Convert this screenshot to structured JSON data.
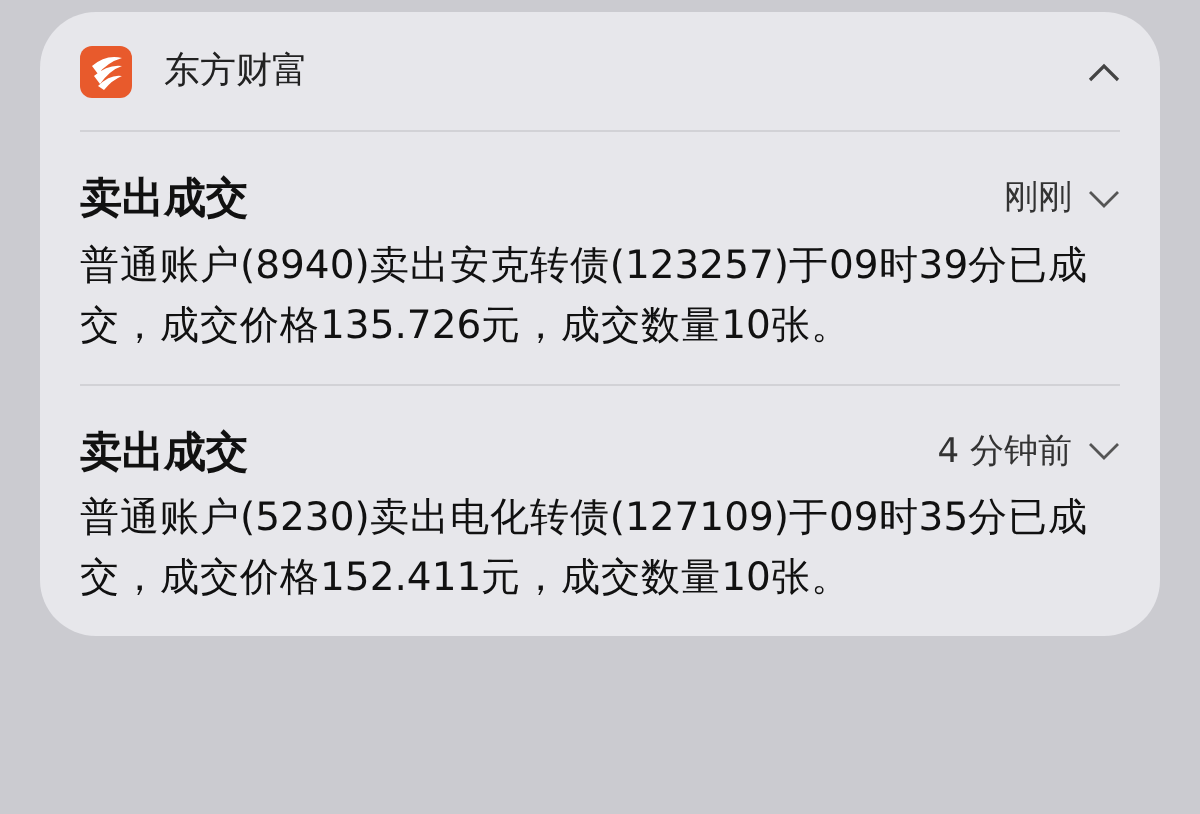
{
  "app": {
    "name": "东方财富",
    "expanded": true
  },
  "notifications": [
    {
      "title": "卖出成交",
      "time": "刚刚",
      "expanded": false,
      "body": "普通账户(8940)卖出安克转债(123257)于09时39分已成交，成交价格135.726元，成交数量10张。"
    },
    {
      "title": "卖出成交",
      "time": "4 分钟前",
      "expanded": false,
      "body": "普通账户(5230)卖出电化转债(127109)于09时35分已成交，成交价格152.411元，成交数量10张。"
    }
  ]
}
